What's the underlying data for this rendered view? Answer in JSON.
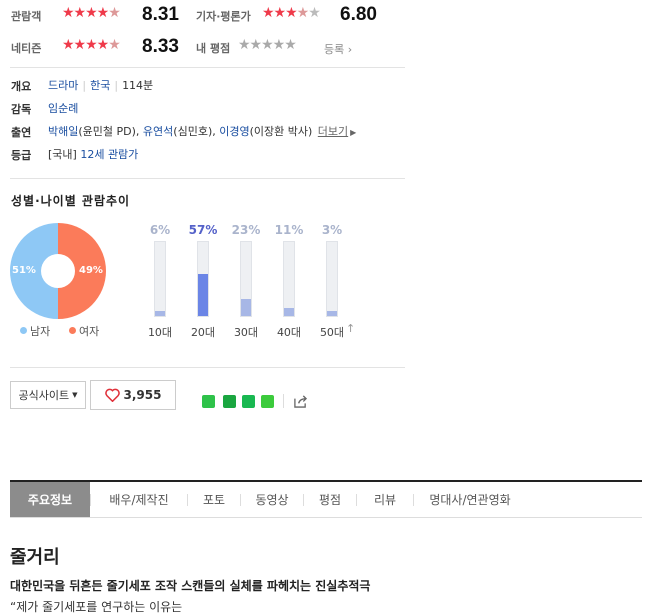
{
  "ratings": {
    "audience": {
      "label": "관람객",
      "stars_on": "★★★★",
      "stars_half": "★",
      "stars_off": "",
      "score": "8.31"
    },
    "critic": {
      "label": "기자·평론가",
      "stars_on": "★★★",
      "stars_half": "★",
      "stars_off": "★",
      "score": "6.80"
    },
    "netizen": {
      "label": "네티즌",
      "stars_on": "★★★★",
      "stars_half": "★",
      "stars_off": "",
      "score": "8.33"
    },
    "mine": {
      "label": "내 평점",
      "stars": "★★★★★",
      "register": "등록"
    }
  },
  "info": {
    "overview_key": "개요",
    "genre": "드라마",
    "country": "한국",
    "runtime": "114분",
    "director_key": "감독",
    "director": "임순례",
    "cast_key": "출연",
    "cast1": "박해일",
    "cast1_role": "(윤민철 PD), ",
    "cast2": "유연석",
    "cast2_role": "(심민호), ",
    "cast3": "이경영",
    "cast3_role": "(이장환 박사)",
    "more": "더보기",
    "grade_key": "등급",
    "grade_region": "[국내] ",
    "grade": "12세 관람가"
  },
  "trend": {
    "title": "성별·나이별 관람추이",
    "male_pct": "51%",
    "female_pct": "49%",
    "male_label": "남자",
    "female_label": "여자",
    "male_color": "#8ec8f5",
    "female_color": "#fb7b5a",
    "ages": [
      {
        "label": "10대",
        "pct": "6%",
        "value": 6
      },
      {
        "label": "20대",
        "pct": "57%",
        "value": 57
      },
      {
        "label": "30대",
        "pct": "23%",
        "value": 23
      },
      {
        "label": "40대",
        "pct": "11%",
        "value": 11
      },
      {
        "label": "50대",
        "pct": "3%",
        "value": 3
      }
    ]
  },
  "actions": {
    "official_site": "공식사이트",
    "likes": "3,955"
  },
  "tabs": [
    "주요정보",
    "배우/제작진",
    "포토",
    "동영상",
    "평점",
    "리뷰",
    "명대사/연관영화"
  ],
  "story": {
    "heading": "줄거리",
    "headline": "대한민국을 뒤흔든 줄기세포 조작 스캔들의 실체를 파헤치는 진실추적극",
    "first_line": "“제가 줄기세포를 연구하는 이유는"
  }
}
